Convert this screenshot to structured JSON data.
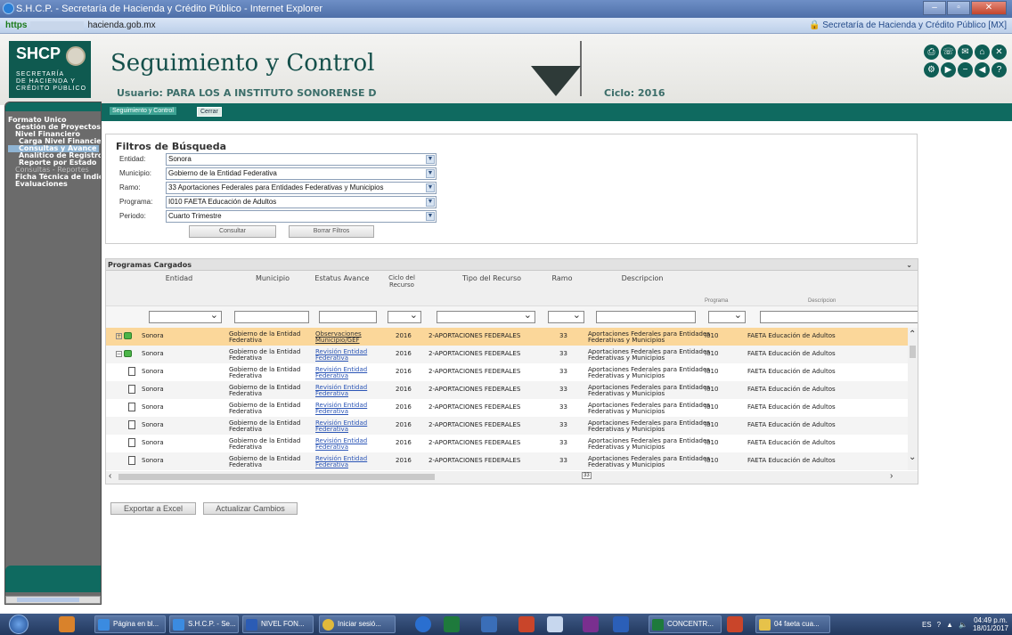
{
  "window": {
    "title": "S.H.C.P. - Secretaría de Hacienda y Crédito Público - Internet Explorer",
    "address_prefix": "https",
    "address_domain": "hacienda.gob.mx",
    "security_label": "Secretaría de Hacienda y Crédito Público [MX]"
  },
  "header": {
    "logo_big": "SHCP",
    "logo_small": [
      "SECRETARÍA",
      "DE HACIENDA Y",
      "CRÉDITO PÚBLICO"
    ],
    "title": "Seguimiento y Control",
    "user": "Usuario: PARA LOS A INSTITUTO SONORENSE D",
    "ciclo": "Ciclo: 2016",
    "icons": [
      "printer-icon",
      "phone-icon",
      "mail-icon",
      "home-icon",
      "close-icon",
      "gear-icon",
      "play-icon",
      "minus-icon",
      "back-icon",
      "help-icon"
    ]
  },
  "tabs": {
    "tab1": "Seguimiento y Control",
    "tab2": "Cerrar"
  },
  "sidebar": {
    "items": [
      "Formato Único",
      "Gestión de Proyectos",
      "Nivel Financiero",
      "Carga Nivel Financiero",
      "Consultas y Avance",
      "Analítico de Registro",
      "Reporte por Estado",
      "Consultas - Reportes",
      "Ficha Técnica de Indicadores",
      "Evaluaciones"
    ]
  },
  "filters": {
    "title": "Filtros de Búsqueda",
    "fields": [
      {
        "label": "Entidad:",
        "value": "Sonora"
      },
      {
        "label": "Municipio:",
        "value": "Gobierno de la Entidad Federativa"
      },
      {
        "label": "Ramo:",
        "value": "33 Aportaciones Federales para Entidades Federativas y Municipios"
      },
      {
        "label": "Programa:",
        "value": "I010 FAETA Educación de Adultos"
      },
      {
        "label": "Periodo:",
        "value": "Cuarto Trimestre"
      }
    ],
    "consultar": "Consultar",
    "borrar": "Borrar Filtros"
  },
  "grid": {
    "title": "Programas Cargados",
    "columns": {
      "entidad": "Entidad",
      "municipio": "Municipio",
      "estatus": "Estatus Avance",
      "ciclo_l1": "Ciclo del",
      "ciclo_l2": "Recurso",
      "tipo": "Tipo del Recurso",
      "ramo": "Ramo",
      "descripcion": "Descripcion",
      "programa": "Programa",
      "prog_desc": "Descripcion"
    },
    "rows": [
      {
        "entidad": "Sonora",
        "mun1": "Gobierno de la Entidad",
        "mun2": "Federativa",
        "est1": "Observaciones",
        "est2": "Municipio/GEF",
        "ciclo": "2016",
        "tipo": "2-APORTACIONES FEDERALES",
        "ramo": "33",
        "desc1": "Aportaciones Federales para Entidades",
        "desc2": "Federativas y Municipios",
        "prog": "I010",
        "prog_desc": "FAETA Educación de Adultos"
      },
      {
        "entidad": "Sonora",
        "mun1": "Gobierno de la Entidad",
        "mun2": "Federativa",
        "est1": "Revisión Entidad",
        "est2": "Federativa",
        "ciclo": "2016",
        "tipo": "2-APORTACIONES FEDERALES",
        "ramo": "33",
        "desc1": "Aportaciones Federales para Entidades",
        "desc2": "Federativas y Municipios",
        "prog": "I010",
        "prog_desc": "FAETA Educación de Adultos"
      },
      {
        "entidad": "Sonora",
        "mun1": "Gobierno de la Entidad",
        "mun2": "Federativa",
        "est1": "Revisión Entidad",
        "est2": "Federativa",
        "ciclo": "2016",
        "tipo": "2-APORTACIONES FEDERALES",
        "ramo": "33",
        "desc1": "Aportaciones Federales para Entidades",
        "desc2": "Federativas y Municipios",
        "prog": "I010",
        "prog_desc": "FAETA Educación de Adultos"
      },
      {
        "entidad": "Sonora",
        "mun1": "Gobierno de la Entidad",
        "mun2": "Federativa",
        "est1": "Revisión Entidad",
        "est2": "Federativa",
        "ciclo": "2016",
        "tipo": "2-APORTACIONES FEDERALES",
        "ramo": "33",
        "desc1": "Aportaciones Federales para Entidades",
        "desc2": "Federativas y Municipios",
        "prog": "I010",
        "prog_desc": "FAETA Educación de Adultos"
      },
      {
        "entidad": "Sonora",
        "mun1": "Gobierno de la Entidad",
        "mun2": "Federativa",
        "est1": "Revisión Entidad",
        "est2": "Federativa",
        "ciclo": "2016",
        "tipo": "2-APORTACIONES FEDERALES",
        "ramo": "33",
        "desc1": "Aportaciones Federales para Entidades",
        "desc2": "Federativas y Municipios",
        "prog": "I010",
        "prog_desc": "FAETA Educación de Adultos"
      },
      {
        "entidad": "Sonora",
        "mun1": "Gobierno de la Entidad",
        "mun2": "Federativa",
        "est1": "Revisión Entidad",
        "est2": "Federativa",
        "ciclo": "2016",
        "tipo": "2-APORTACIONES FEDERALES",
        "ramo": "33",
        "desc1": "Aportaciones Federales para Entidades",
        "desc2": "Federativas y Municipios",
        "prog": "I010",
        "prog_desc": "FAETA Educación de Adultos"
      },
      {
        "entidad": "Sonora",
        "mun1": "Gobierno de la Entidad",
        "mun2": "Federativa",
        "est1": "Revisión Entidad",
        "est2": "Federativa",
        "ciclo": "2016",
        "tipo": "2-APORTACIONES FEDERALES",
        "ramo": "33",
        "desc1": "Aportaciones Federales para Entidades",
        "desc2": "Federativas y Municipios",
        "prog": "I010",
        "prog_desc": "FAETA Educación de Adultos"
      },
      {
        "entidad": "Sonora",
        "mun1": "Gobierno de la Entidad",
        "mun2": "Federativa",
        "est1": "Revisión Entidad",
        "est2": "Federativa",
        "ciclo": "2016",
        "tipo": "2-APORTACIONES FEDERALES",
        "ramo": "33",
        "desc1": "Aportaciones Federales para Entidades",
        "desc2": "Federativas y Municipios",
        "prog": "I010",
        "prog_desc": "FAETA Educación de Adultos"
      }
    ],
    "tooltip": "33"
  },
  "actions": {
    "excel": "Exportar a Excel",
    "update": "Actualizar Cambios"
  },
  "taskbar": {
    "items": [
      "Página en bl...",
      "S.H.C.P. - Se...",
      "NIVEL FON...",
      "Iniciar sesió...",
      "CONCENTR...",
      "04 faeta cua..."
    ],
    "lang": "ES",
    "time": "04:49 p.m.",
    "date": "18/01/2017"
  }
}
